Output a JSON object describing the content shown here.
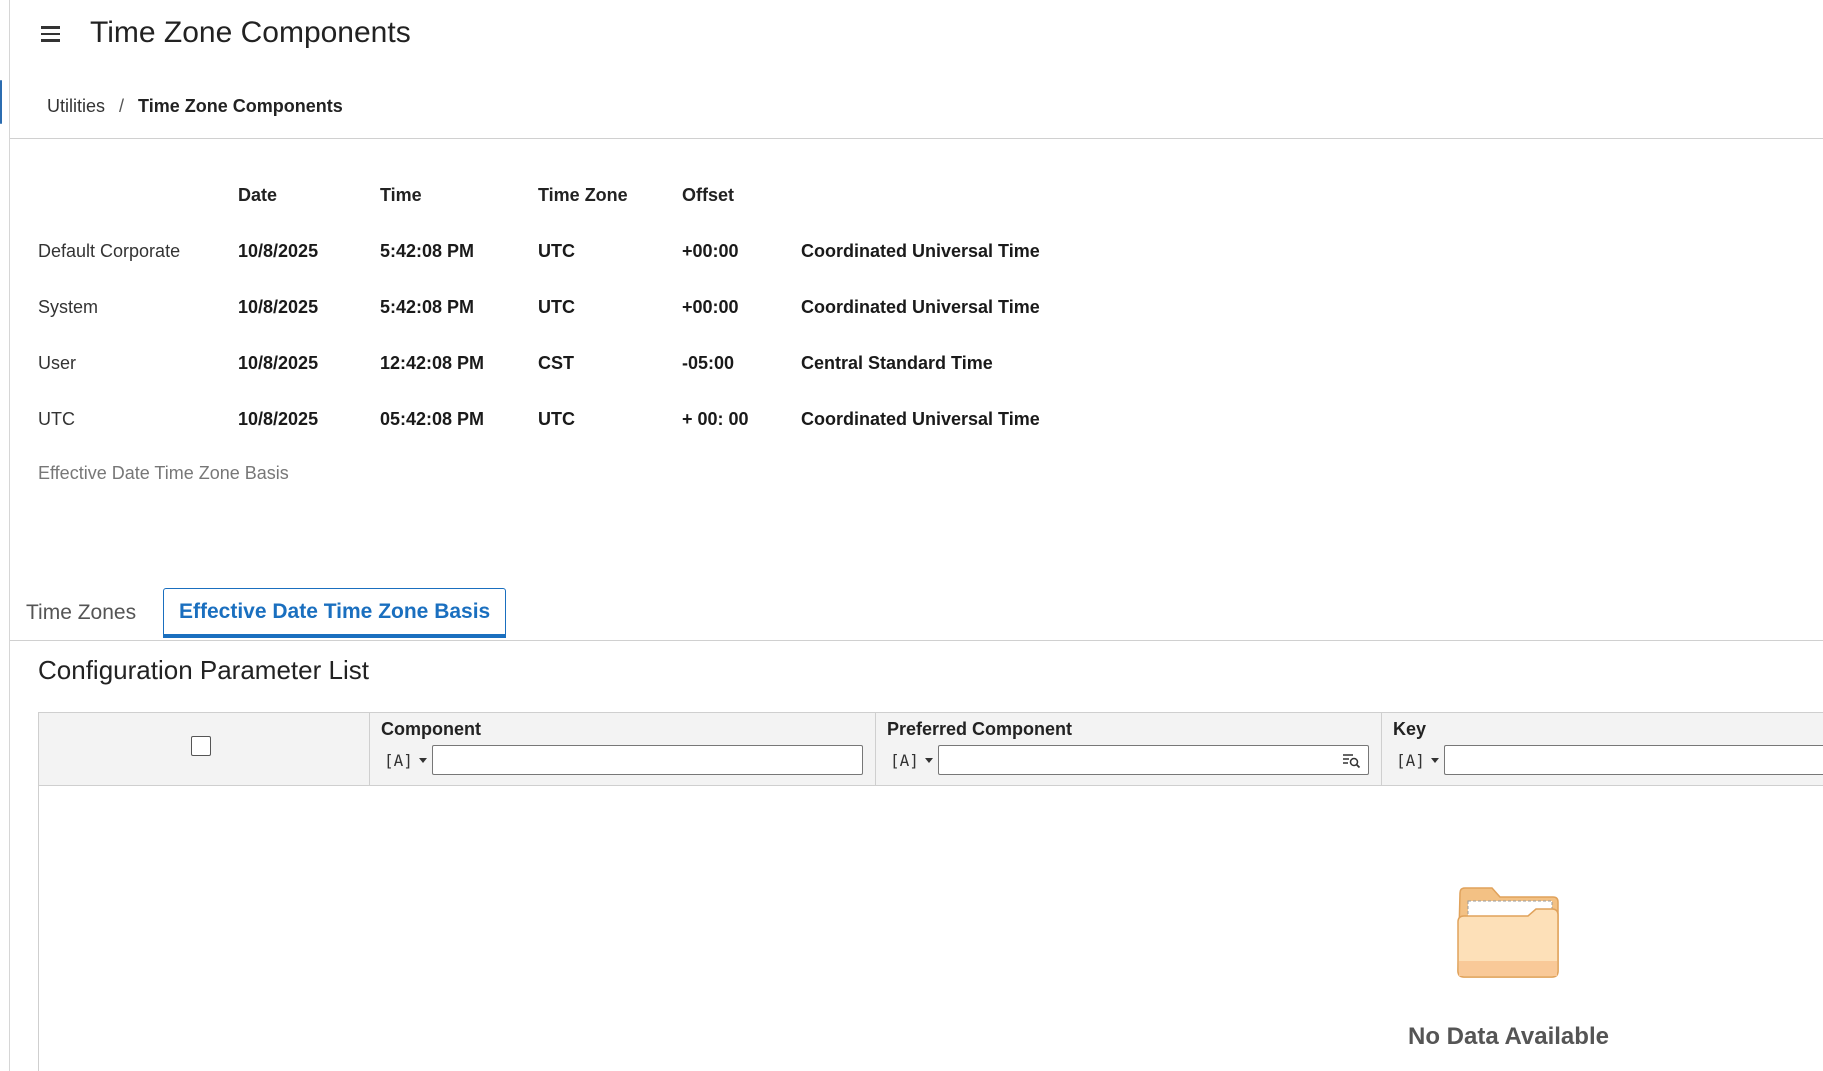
{
  "header": {
    "title": "Time Zone Components"
  },
  "breadcrumb": {
    "parent": "Utilities",
    "separator": "/",
    "current": "Time Zone Components"
  },
  "timezone_table": {
    "columns": [
      "Date",
      "Time",
      "Time Zone",
      "Offset"
    ],
    "rows": [
      {
        "label": "Default Corporate",
        "date": "10/8/2025",
        "time": "5:42:08 PM",
        "zone": "UTC",
        "offset": "+00:00",
        "name": "Coordinated Universal Time"
      },
      {
        "label": "System",
        "date": "10/8/2025",
        "time": "5:42:08 PM",
        "zone": "UTC",
        "offset": "+00:00",
        "name": "Coordinated Universal Time"
      },
      {
        "label": "User",
        "date": "10/8/2025",
        "time": "12:42:08 PM",
        "zone": "CST",
        "offset": "-05:00",
        "name": "Central Standard Time"
      },
      {
        "label": "UTC",
        "date": "10/8/2025",
        "time": "05:42:08 PM",
        "zone": "UTC",
        "offset": "+ 00: 00",
        "name": "Coordinated Universal Time"
      }
    ],
    "basis_link": "Effective Date Time Zone Basis"
  },
  "tabs": [
    {
      "label": "Time Zones",
      "active": false
    },
    {
      "label": "Effective Date Time Zone Basis",
      "active": true
    }
  ],
  "grid": {
    "title": "Configuration Parameter List",
    "filter_operator": "[A]",
    "columns": [
      {
        "label": "Component",
        "filter_value": ""
      },
      {
        "label": "Preferred Component",
        "filter_value": ""
      },
      {
        "label": "Key",
        "filter_value": ""
      }
    ],
    "empty_message": "No Data Available"
  },
  "colors": {
    "accent": "#1a6fbf",
    "folder_fill": "#fdd9a8",
    "folder_stroke": "#e6a55a"
  },
  "icons": {
    "menu": "hamburger-menu-icon",
    "lookup": "search-list-icon",
    "empty": "folder-icon"
  }
}
